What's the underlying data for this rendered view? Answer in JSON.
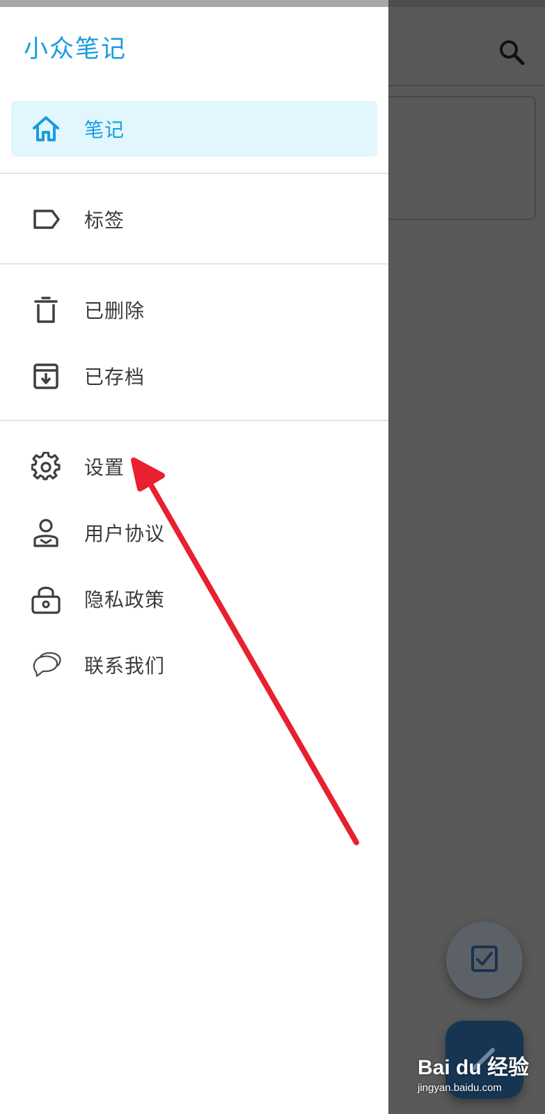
{
  "app": {
    "title": "小众笔记"
  },
  "drawer": {
    "items": [
      {
        "label": "笔记",
        "icon": "home-icon",
        "active": true
      },
      {
        "label": "标签",
        "icon": "label-icon",
        "active": false
      },
      {
        "label": "已删除",
        "icon": "trash-icon",
        "active": false
      },
      {
        "label": "已存档",
        "icon": "archive-icon",
        "active": false
      },
      {
        "label": "设置",
        "icon": "gear-icon",
        "active": false
      },
      {
        "label": "用户协议",
        "icon": "user-agreement-icon",
        "active": false
      },
      {
        "label": "隐私政策",
        "icon": "lock-icon",
        "active": false
      },
      {
        "label": "联系我们",
        "icon": "chat-bubbles-icon",
        "active": false
      }
    ]
  },
  "background": {
    "search_icon": "search-icon",
    "fab_checklist_icon": "checkbox-icon",
    "fab_new_note_icon": "pencil-icon"
  },
  "colors": {
    "accent": "#1a9be0",
    "active_bg": "#e1f7fd",
    "text": "#3b3b3b",
    "scrim": "#595959",
    "fab_dark": "#153553",
    "annotation_arrow": "#e8202f"
  },
  "watermark": {
    "logo": "Bai du 经验",
    "url": "jingyan.baidu.com"
  }
}
